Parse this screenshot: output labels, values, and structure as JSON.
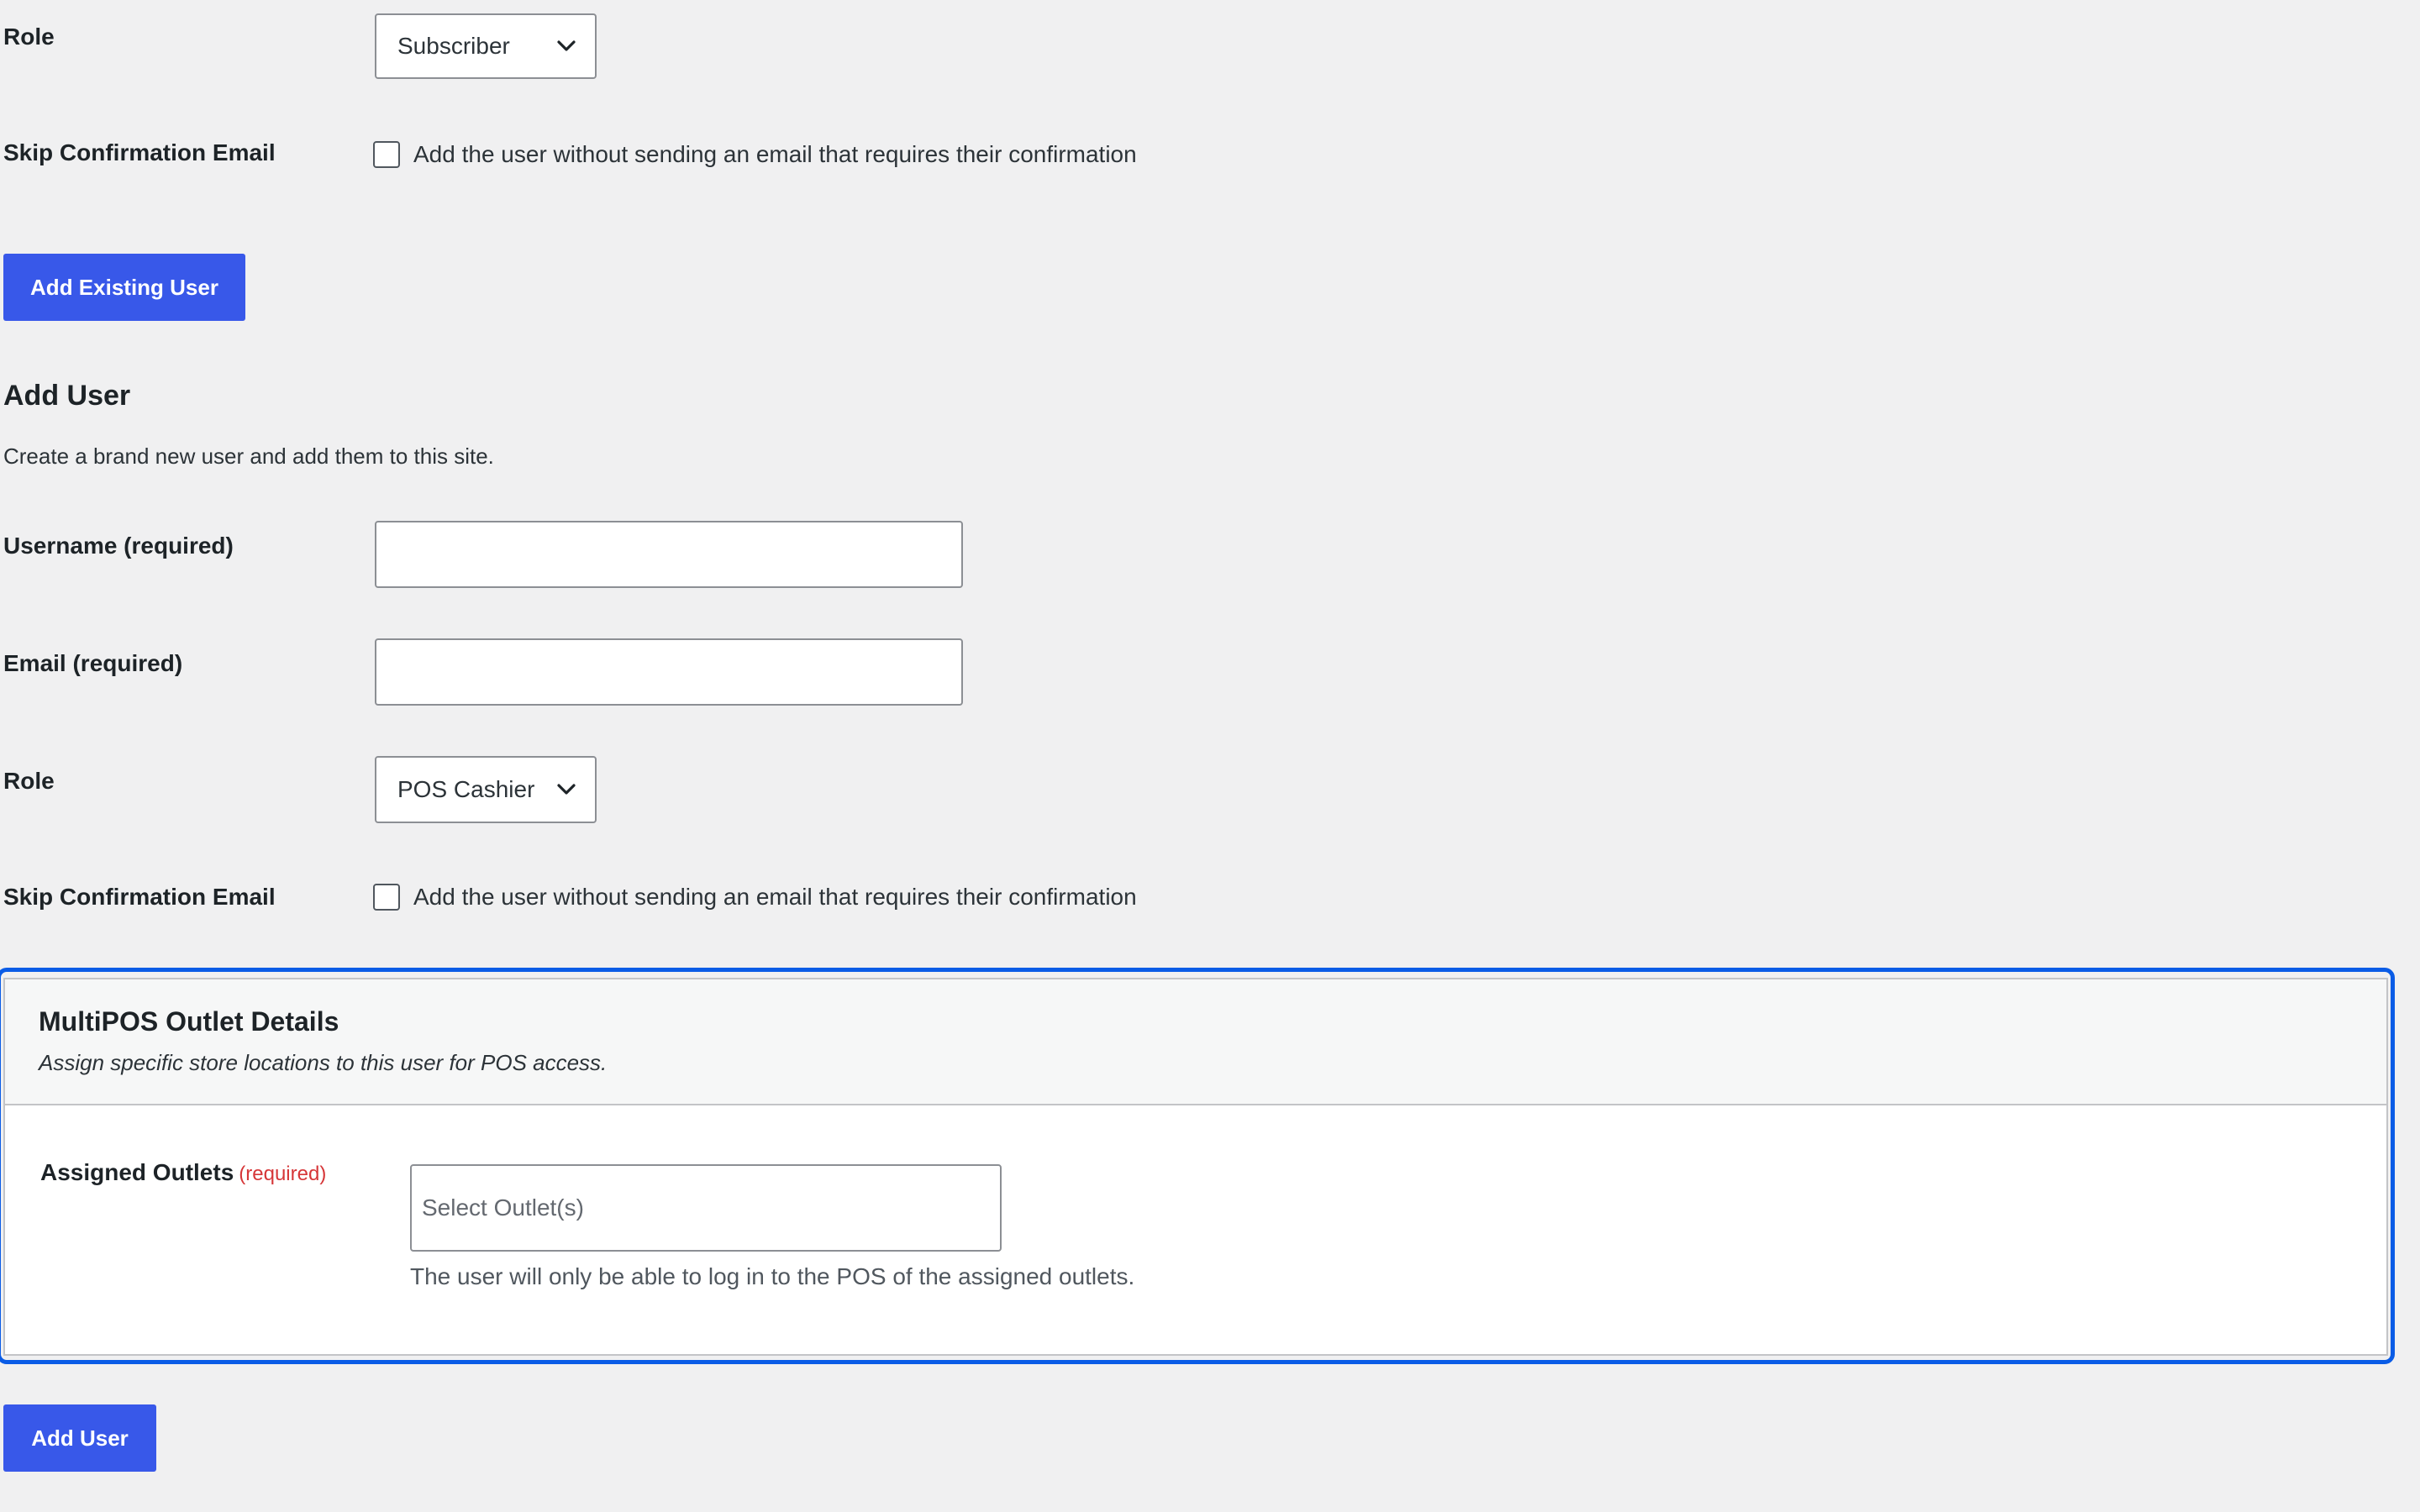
{
  "existing_user": {
    "role_label": "Role",
    "role_value": "Subscriber",
    "skip_label": "Skip Confirmation Email",
    "skip_text": "Add the user without sending an email that requires their confirmation",
    "submit_label": "Add Existing User"
  },
  "add_user": {
    "heading": "Add User",
    "description": "Create a brand new user and add them to this site.",
    "username_label": "Username (required)",
    "username_value": "",
    "email_label": "Email (required)",
    "email_value": "",
    "role_label": "Role",
    "role_value": "POS Cashier",
    "skip_label": "Skip Confirmation Email",
    "skip_text": "Add the user without sending an email that requires their confirmation",
    "submit_label": "Add User"
  },
  "multipos": {
    "title": "MultiPOS Outlet Details",
    "subtitle": "Assign specific store locations to this user for POS access.",
    "outlets_label": "Assigned Outlets",
    "required_text": "(required)",
    "outlets_placeholder": "Select Outlet(s)",
    "help_text": "The user will only be able to log in to the POS of the assigned outlets."
  },
  "icons": {
    "select_arrow": "chevron-down-icon"
  },
  "colors": {
    "primary_button": "#3858e9",
    "focus_ring": "#0a5ce6",
    "required": "#d63638",
    "background": "#f0f0f1"
  }
}
